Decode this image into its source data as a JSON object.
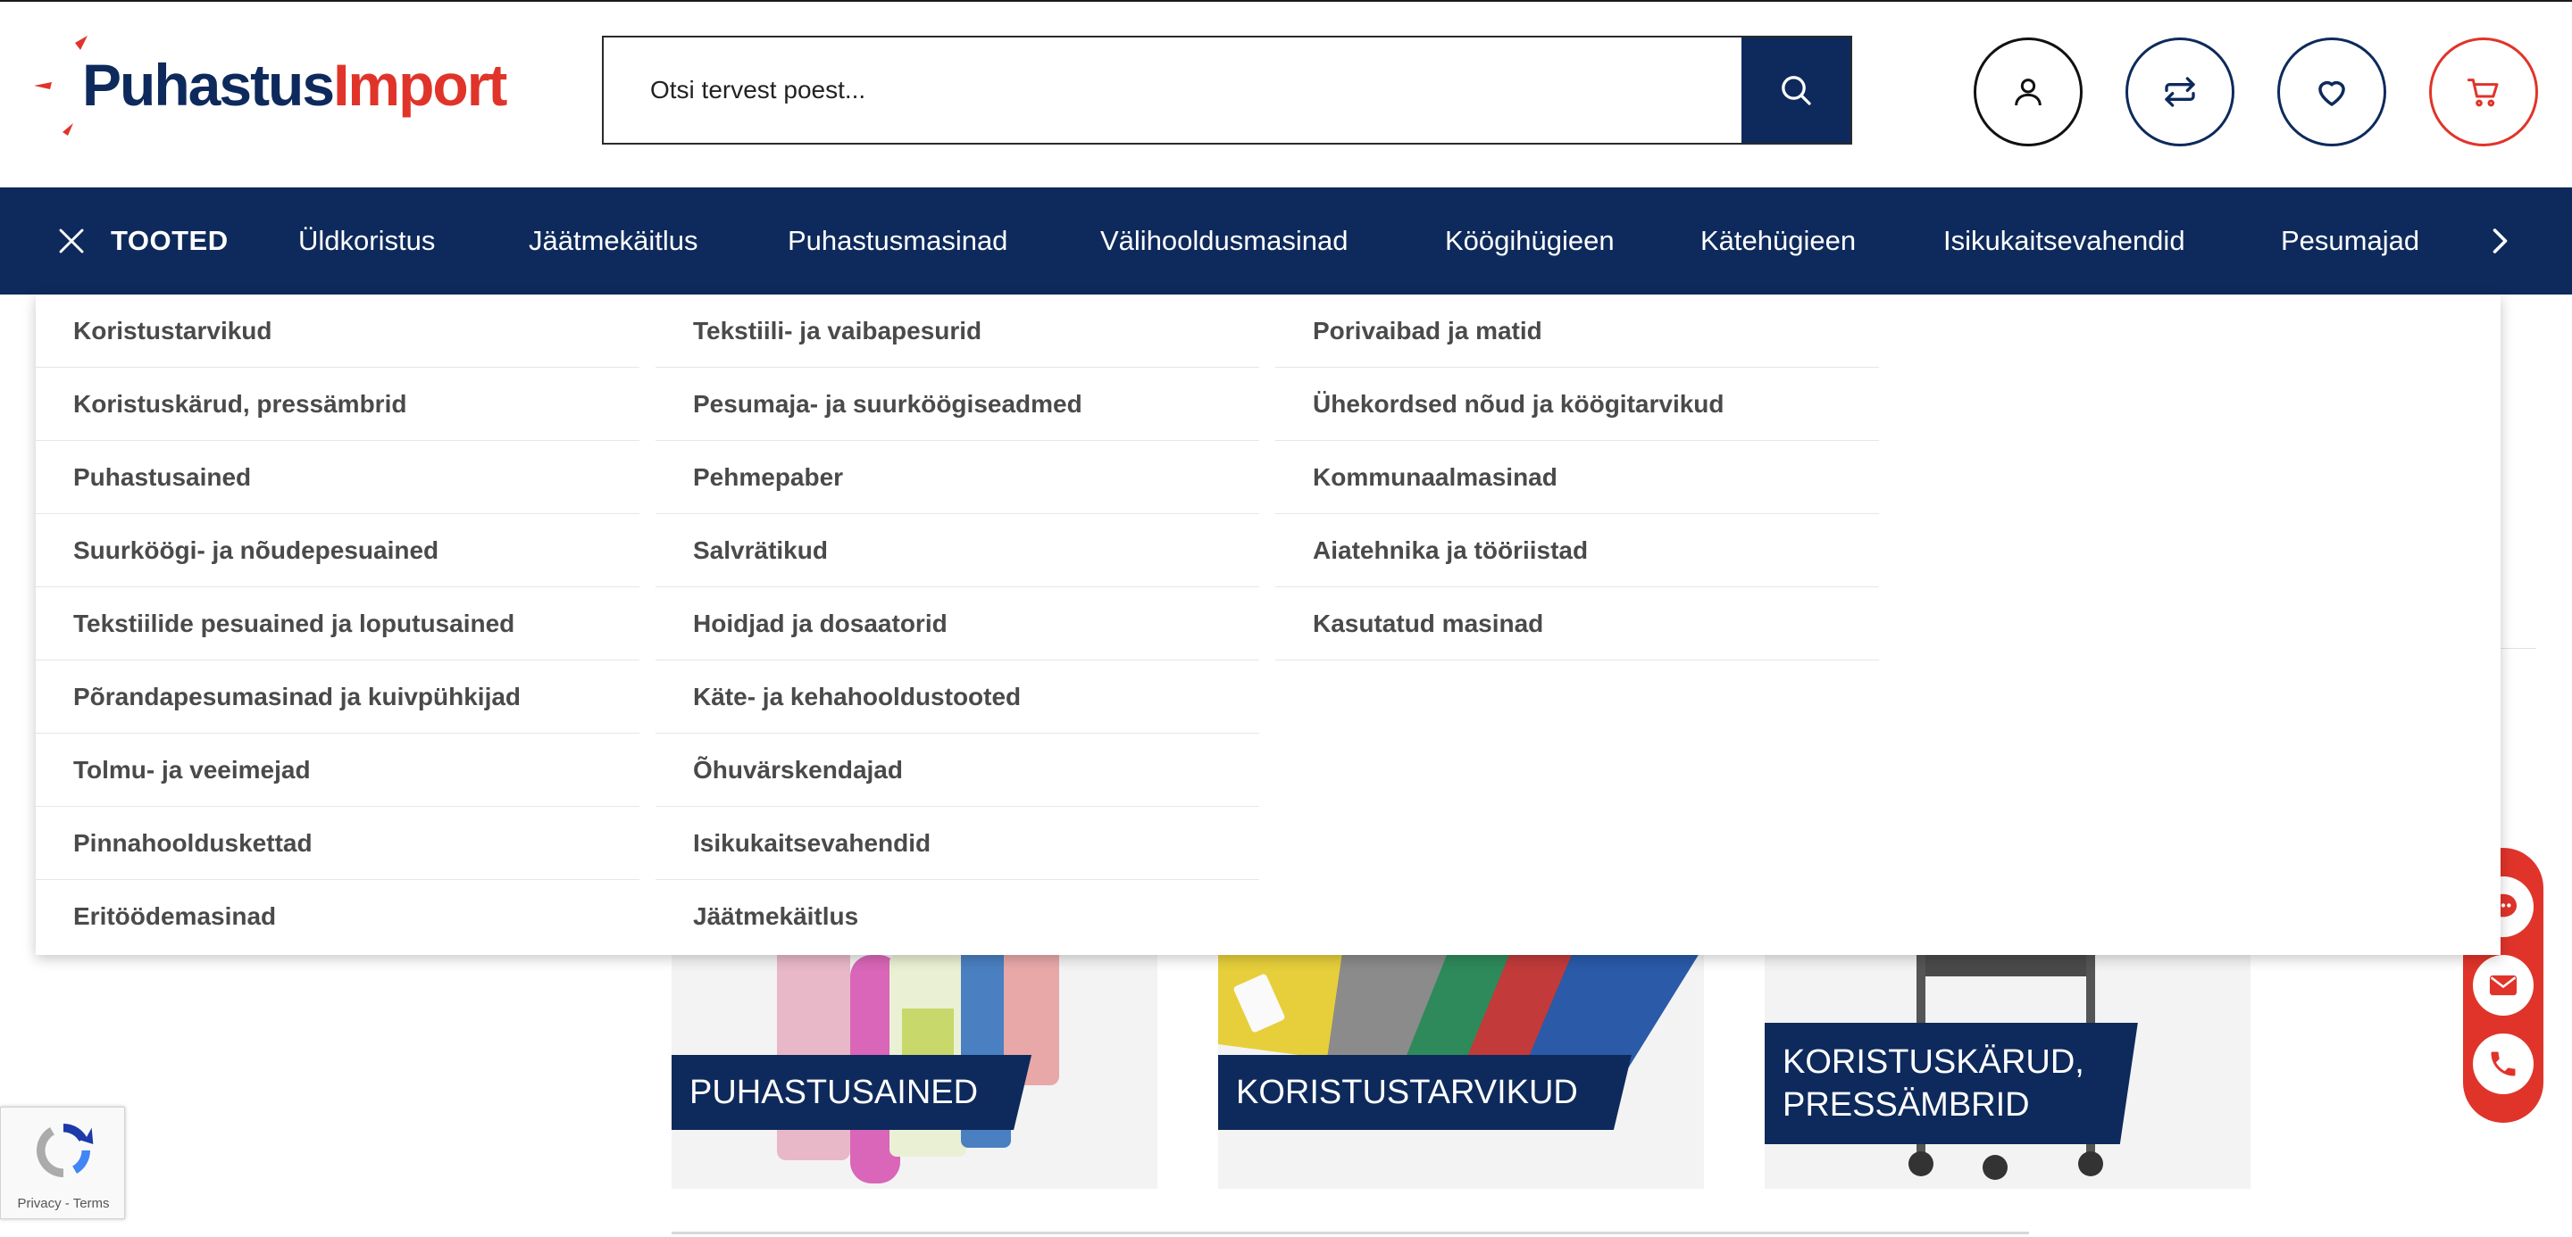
{
  "header": {
    "logo": {
      "part1": "Puhastus",
      "part2": "Import"
    },
    "search": {
      "placeholder": "Otsi tervest poest..."
    }
  },
  "nav": {
    "tooted_label": "TOOTED",
    "items": [
      "Üldkoristus",
      "Jäätmekäitlus",
      "Puhastusmasinad",
      "Välihooldusmasinad",
      "Köögihügieen",
      "Kätehügieen",
      "Isikukaitsevahendid",
      "Pesumajad"
    ]
  },
  "menu": {
    "col1": [
      "Koristustarvikud",
      "Koristuskärud, pressämbrid",
      "Puhastusained",
      "Suurköögi- ja nõudepesuained",
      "Tekstiilide pesuained ja loputusained",
      "Põrandapesumasinad ja kuivpühkijad",
      "Tolmu- ja veeimejad",
      "Pinnahoolduskettad",
      "Eritöödemasinad"
    ],
    "col2": [
      "Tekstiili- ja vaibapesurid",
      "Pesumaja- ja suurköögiseadmed",
      "Pehmepaber",
      "Salvrätikud",
      "Hoidjad ja dosaatorid",
      "Käte- ja kehahooldustooted",
      "Õhuvärskendajad",
      "Isikukaitsevahendid",
      "Jäätmekäitlus"
    ],
    "col3": [
      "Porivaibad ja matid",
      "Ühekordsed nõud ja köögitarvikud",
      "Kommunaalmasinad",
      "Aiatehnika ja tööriistad",
      "Kasutatud masinad"
    ]
  },
  "cards": [
    {
      "line1": "PUHASTUSAINED",
      "line2": ""
    },
    {
      "line1": "KORISTUSTARVIKUD",
      "line2": ""
    },
    {
      "line1": "KORISTUSKÄRUD,",
      "line2": "PRESSÄMBRID"
    }
  ],
  "recaptcha": {
    "privacy": "Privacy",
    "sep": " - ",
    "terms": "Terms"
  },
  "colors": {
    "brand_navy": "#0e2a5c",
    "brand_red": "#e0342a"
  },
  "icons": [
    "user-icon",
    "compare-icon",
    "heart-icon",
    "cart-icon",
    "search-icon",
    "close-icon",
    "chevron-right-icon",
    "chat-icon",
    "mail-icon",
    "phone-icon"
  ]
}
